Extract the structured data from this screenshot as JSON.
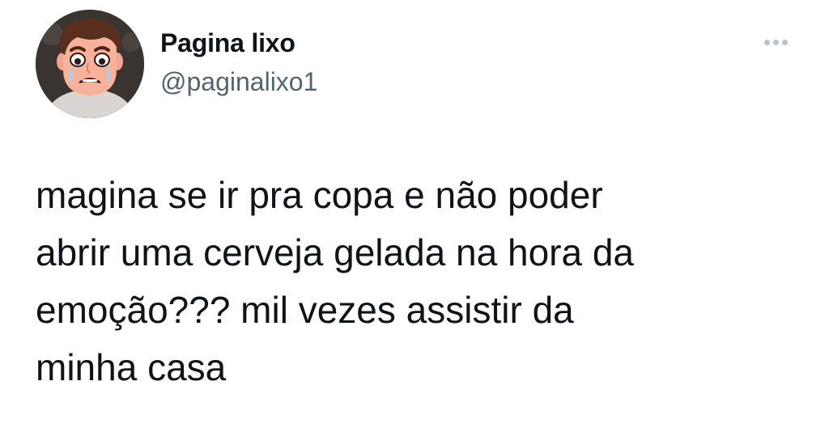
{
  "author": {
    "display_name": "Pagina lixo",
    "handle": "@paginalixo1",
    "avatar_icon": "cartoon-crying-face-avatar"
  },
  "more_menu": {
    "icon": "more-horizontal-icon"
  },
  "tweet": {
    "text": "magina se ir pra copa e não poder\nabrir uma cerveja gelada na hora da\nemoção??? mil vezes assistir da\nminha casa"
  },
  "colors": {
    "text_primary": "#0f1419",
    "text_secondary": "#536471",
    "more_dots": "#b9c3cc",
    "background": "#ffffff"
  }
}
